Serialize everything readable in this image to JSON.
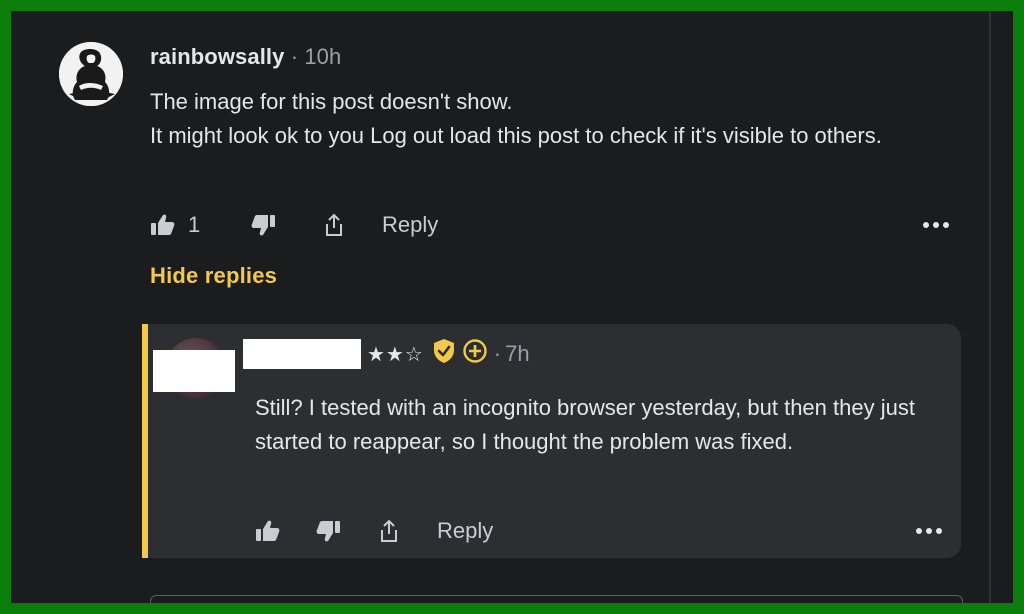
{
  "comment": {
    "username": "rainbowsally",
    "separator": "·",
    "time": "10h",
    "body_lines": [
      "The image for this post doesn't show.",
      "It might look ok to you Log out load this post to check if it's visible to others."
    ],
    "like_count": "1",
    "reply_label": "Reply",
    "hide_replies_label": "Hide replies"
  },
  "reply": {
    "stars": "★★☆",
    "separator": "·",
    "time": "7h",
    "body": "Still? I tested with an incognito browser yesterday, but then they just started to reappear, so I thought the problem was fixed.",
    "reply_label": "Reply"
  },
  "colors": {
    "accent": "#f3c94b",
    "background": "#1b1c1e",
    "card": "#2d2e31",
    "frame": "#0b7d0b"
  },
  "icons": {
    "like": "thumbs-up-icon",
    "dislike": "thumbs-down-icon",
    "share": "share-icon",
    "more": "more-icon",
    "verified": "verified-shield-icon",
    "add": "plus-circle-icon"
  }
}
